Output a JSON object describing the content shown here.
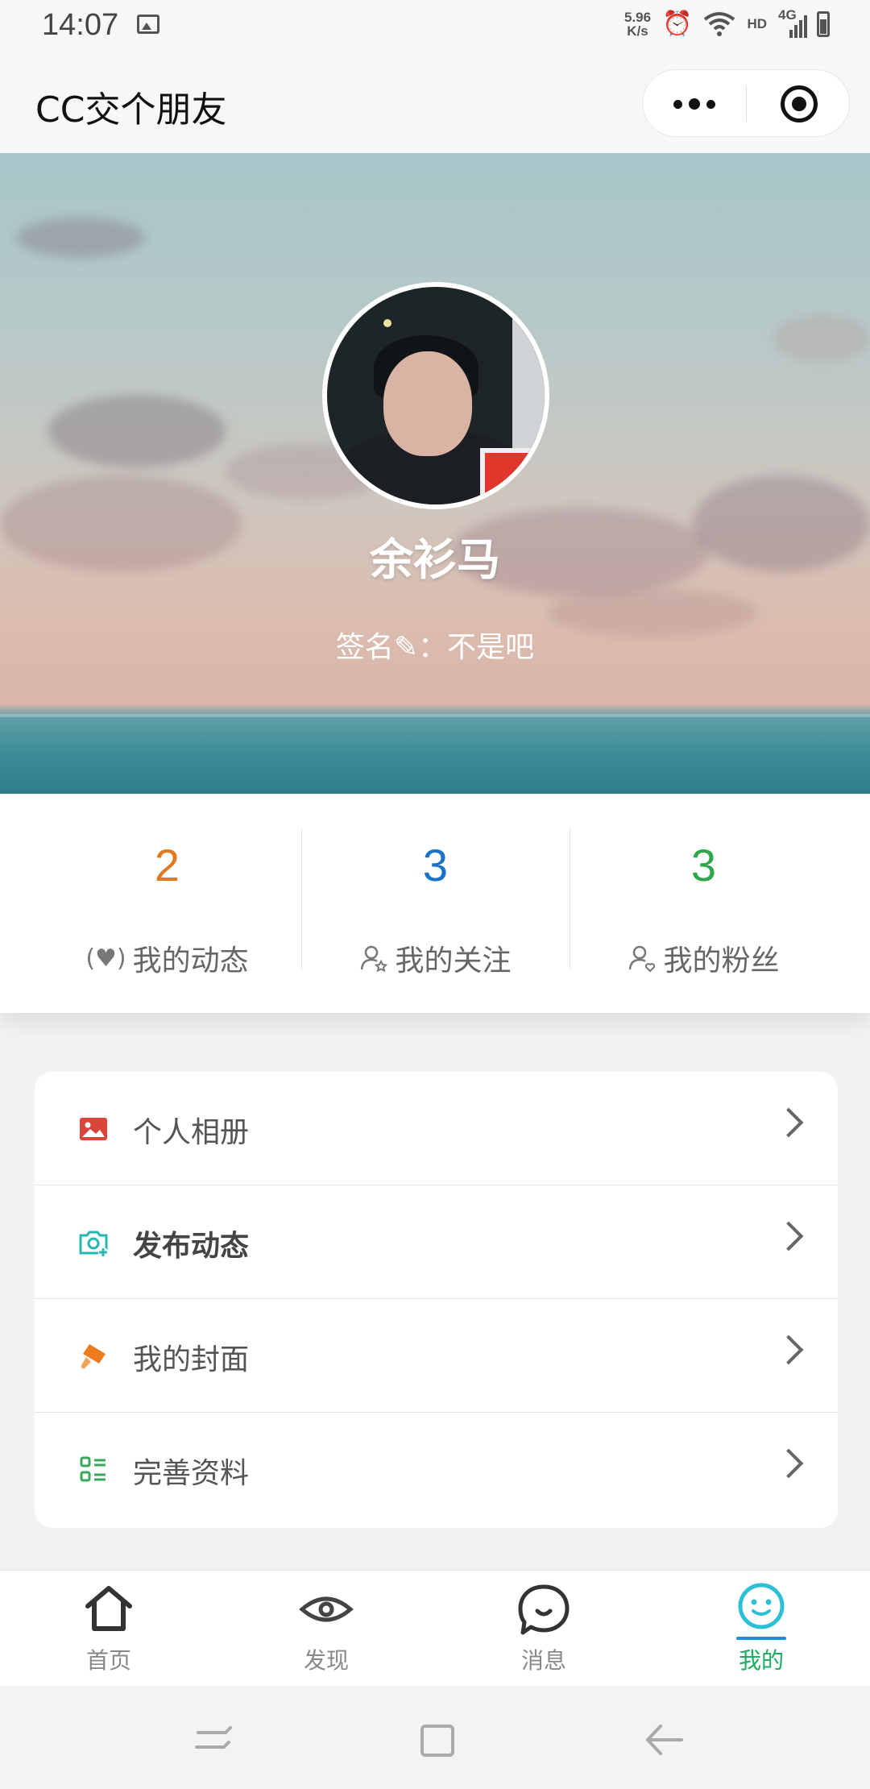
{
  "status_bar": {
    "time": "14:07",
    "net_speed_value": "5.96",
    "net_speed_unit": "K/s",
    "hd": "HD",
    "network": "4G",
    "icons": [
      "image-icon",
      "alarm-icon",
      "wifi-icon",
      "signal-icon",
      "battery-icon"
    ]
  },
  "app": {
    "title": "CC交个朋友",
    "capsule_icons": [
      "more-icon",
      "close-target-icon"
    ]
  },
  "profile": {
    "username": "余衫马",
    "signature": "签名✎：不是吧"
  },
  "stats": [
    {
      "value": "2",
      "label": "我的动态",
      "color": "#e07a20",
      "icon": "broadcast-heart-icon"
    },
    {
      "value": "3",
      "label": "我的关注",
      "color": "#1a73c8",
      "icon": "user-star-icon"
    },
    {
      "value": "3",
      "label": "我的粉丝",
      "color": "#2ea84a",
      "icon": "user-heart-icon"
    }
  ],
  "menu": [
    {
      "label": "个人相册",
      "icon": "picture-icon",
      "icon_color": "#d9453b",
      "bold": false
    },
    {
      "label": "发布动态",
      "icon": "camera-plus-icon",
      "icon_color": "#26b7b0",
      "bold": true
    },
    {
      "label": "我的封面",
      "icon": "brush-icon",
      "icon_color": "#ee7a1e",
      "bold": false
    },
    {
      "label": "完善资料",
      "icon": "list-icon",
      "icon_color": "#3aa85a",
      "bold": false
    }
  ],
  "tabs": [
    {
      "label": "首页",
      "icon": "home-icon",
      "active": false
    },
    {
      "label": "发现",
      "icon": "eye-icon",
      "active": false
    },
    {
      "label": "消息",
      "icon": "chat-bubble-icon",
      "active": false
    },
    {
      "label": "我的",
      "icon": "smiley-icon",
      "active": true
    }
  ],
  "colors": {
    "active_tab": "#1aad5f",
    "active_underline": "#1a8fd6"
  }
}
